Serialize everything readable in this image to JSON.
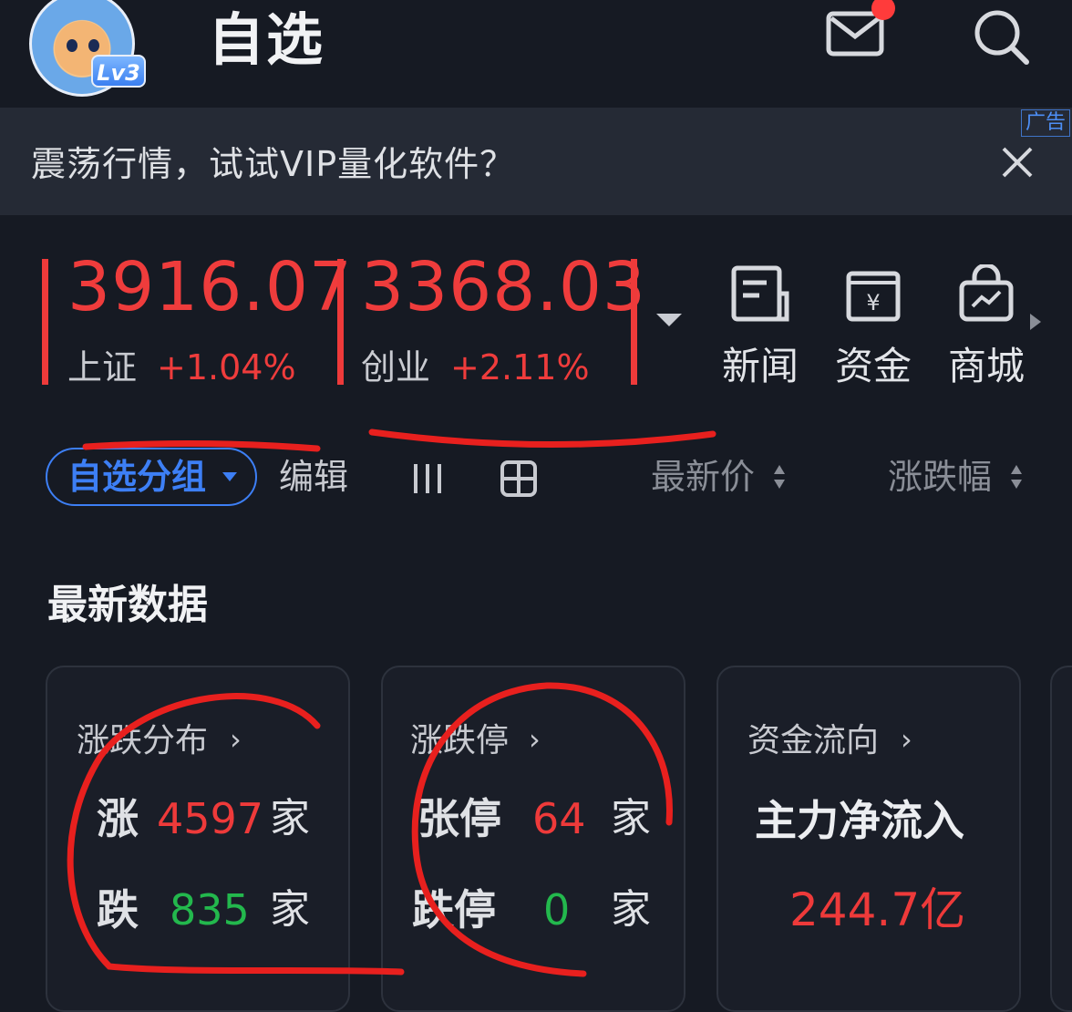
{
  "header": {
    "avatar_badge": "Lv3",
    "title": "自选",
    "icons": [
      "mail-icon",
      "search-icon"
    ],
    "has_unread": true
  },
  "ad": {
    "text": "震荡行情，试试VIP量化软件？",
    "tag": "广告"
  },
  "indices": [
    {
      "value": "3916.07",
      "name": "上证",
      "change": "+1.04%"
    },
    {
      "value": "3368.03",
      "name": "创业",
      "change": "+2.11%"
    }
  ],
  "quick_links": [
    {
      "label": "新闻",
      "icon": "news-icon"
    },
    {
      "label": "资金",
      "icon": "fund-icon"
    },
    {
      "label": "商城",
      "icon": "shop-icon"
    }
  ],
  "toolbar": {
    "group_label": "自选分组",
    "edit_label": "编辑",
    "sort_price": "最新价",
    "sort_change": "涨跌幅"
  },
  "section": {
    "title": "最新数据"
  },
  "cards": {
    "distribution": {
      "title": "涨跌分布",
      "up_label": "涨",
      "up_count": "4597",
      "up_unit": "家",
      "down_label": "跌",
      "down_count": "835",
      "down_unit": "家"
    },
    "limit": {
      "title": "涨跌停",
      "up_label": "张停",
      "up_count": "64",
      "up_unit": "家",
      "down_label": "跌停",
      "down_count": "0",
      "down_unit": "家"
    },
    "flow": {
      "title": "资金流向",
      "subtitle": "主力净流入",
      "value": "244.7亿"
    }
  },
  "colors": {
    "up": "#ee3a3a",
    "down": "#23b84d",
    "accent": "#3d7ff5",
    "background": "#161a23"
  }
}
